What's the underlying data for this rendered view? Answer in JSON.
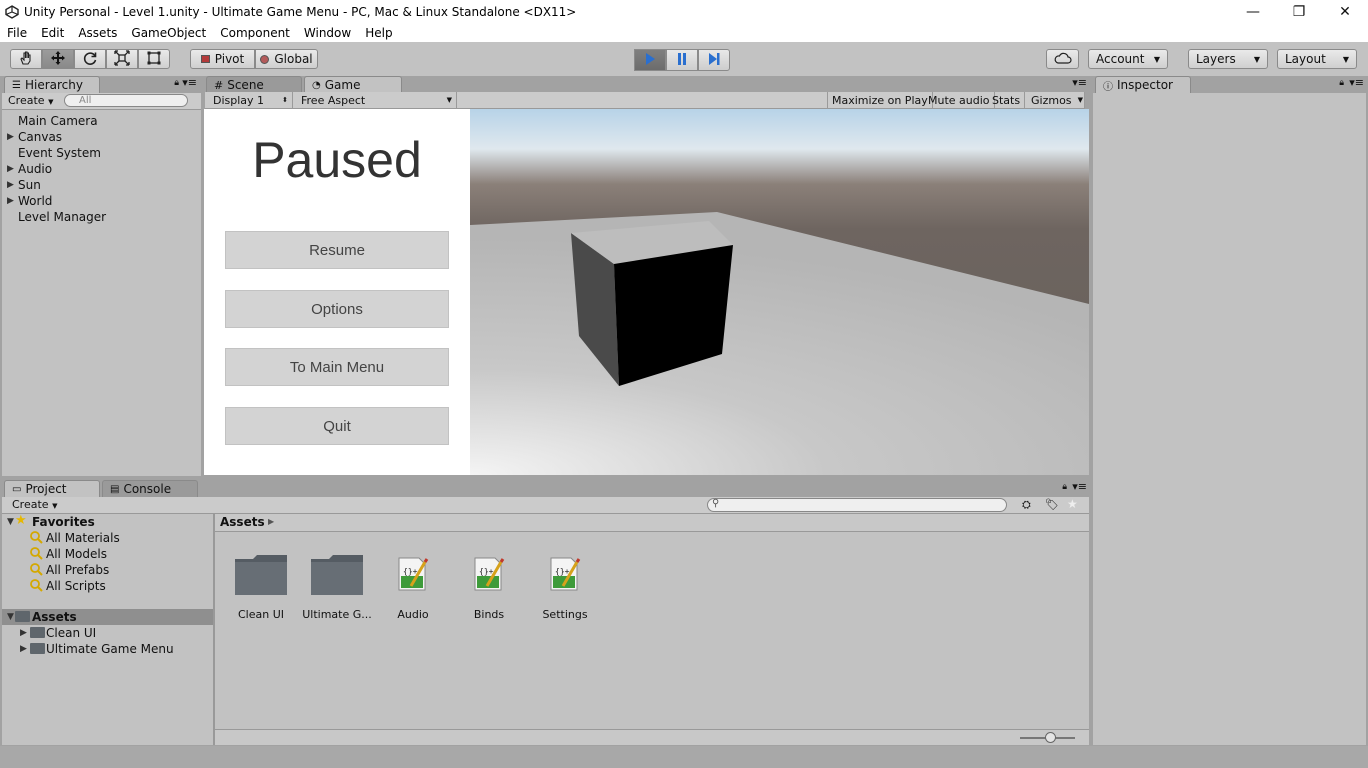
{
  "window": {
    "title": "Unity Personal - Level 1.unity - Ultimate Game Menu - PC, Mac & Linux Standalone <DX11>",
    "minimize": "—",
    "maximize": "❐",
    "close": "✕"
  },
  "menu": [
    "File",
    "Edit",
    "Assets",
    "GameObject",
    "Component",
    "Window",
    "Help"
  ],
  "toolbar": {
    "pivot": "Pivot",
    "global": "Global",
    "account": "Account",
    "layers": "Layers",
    "layout": "Layout",
    "active_tool": "move-tool",
    "play_state": "playing",
    "colors": {
      "play_active": "#2a6fcf",
      "toolbar_bg": "#c2c2c2"
    }
  },
  "hierarchy": {
    "tab": "Hierarchy",
    "create": "Create",
    "search_placeholder": "All",
    "items": [
      "Main Camera",
      "Canvas",
      "Event System",
      "Audio",
      "Sun",
      "World",
      "Level Manager"
    ]
  },
  "scene_tab": "Scene",
  "game": {
    "tab": "Game",
    "display": "Display 1",
    "aspect": "Free Aspect",
    "maximize_on_play": "Maximize on Play",
    "mute_audio": "Mute audio",
    "stats": "Stats",
    "gizmos": "Gizmos",
    "pause_menu": {
      "title": "Paused",
      "buttons": [
        "Resume",
        "Options",
        "To Main Menu",
        "Quit"
      ]
    }
  },
  "inspector": {
    "tab": "Inspector"
  },
  "project": {
    "tab": "Project",
    "console_tab": "Console",
    "create": "Create",
    "favorites": {
      "label": "Favorites",
      "items": [
        "All Materials",
        "All Models",
        "All Prefabs",
        "All Scripts"
      ]
    },
    "assets_root": "Assets",
    "asset_folders": [
      "Clean UI",
      "Ultimate Game Menu"
    ],
    "breadcrumb": "Assets",
    "grid": [
      {
        "label": "Clean UI",
        "icon": "folder-icon"
      },
      {
        "label": "Ultimate G...",
        "icon": "folder-icon"
      },
      {
        "label": "Audio",
        "icon": "script-icon"
      },
      {
        "label": "Binds",
        "icon": "script-icon"
      },
      {
        "label": "Settings",
        "icon": "script-icon"
      }
    ]
  }
}
